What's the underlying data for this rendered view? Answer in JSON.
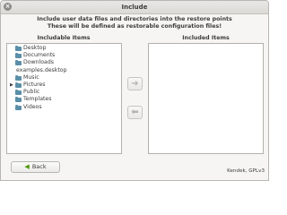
{
  "window": {
    "title": "Include",
    "close_glyph": "×"
  },
  "header": {
    "line1": "Include user data files and directories into the restore points",
    "line2": "These will be defined as restorable configuration files!"
  },
  "left": {
    "title": "Includable Items",
    "items": [
      {
        "label": "Desktop",
        "type": "folder",
        "expandable": false
      },
      {
        "label": "Documents",
        "type": "folder",
        "expandable": false
      },
      {
        "label": "Downloads",
        "type": "folder",
        "expandable": false
      },
      {
        "label": "examples.desktop",
        "type": "file",
        "expandable": false
      },
      {
        "label": "Music",
        "type": "folder",
        "expandable": false
      },
      {
        "label": "Pictures",
        "type": "folder",
        "expandable": true
      },
      {
        "label": "Public",
        "type": "folder",
        "expandable": false
      },
      {
        "label": "Templates",
        "type": "folder",
        "expandable": false
      },
      {
        "label": "Videos",
        "type": "folder",
        "expandable": false
      }
    ]
  },
  "right": {
    "title": "Included Items",
    "items": []
  },
  "buttons": {
    "include_glyph": "➜",
    "exclude_glyph": "⬅",
    "back_label": "Back",
    "back_glyph": "◀"
  },
  "footer": {
    "credit": "Kendek, GPLv3"
  },
  "colors": {
    "folder": "#5b8fa8",
    "back_arrow": "#4e9a06",
    "window_bg": "#f6f5f4"
  }
}
